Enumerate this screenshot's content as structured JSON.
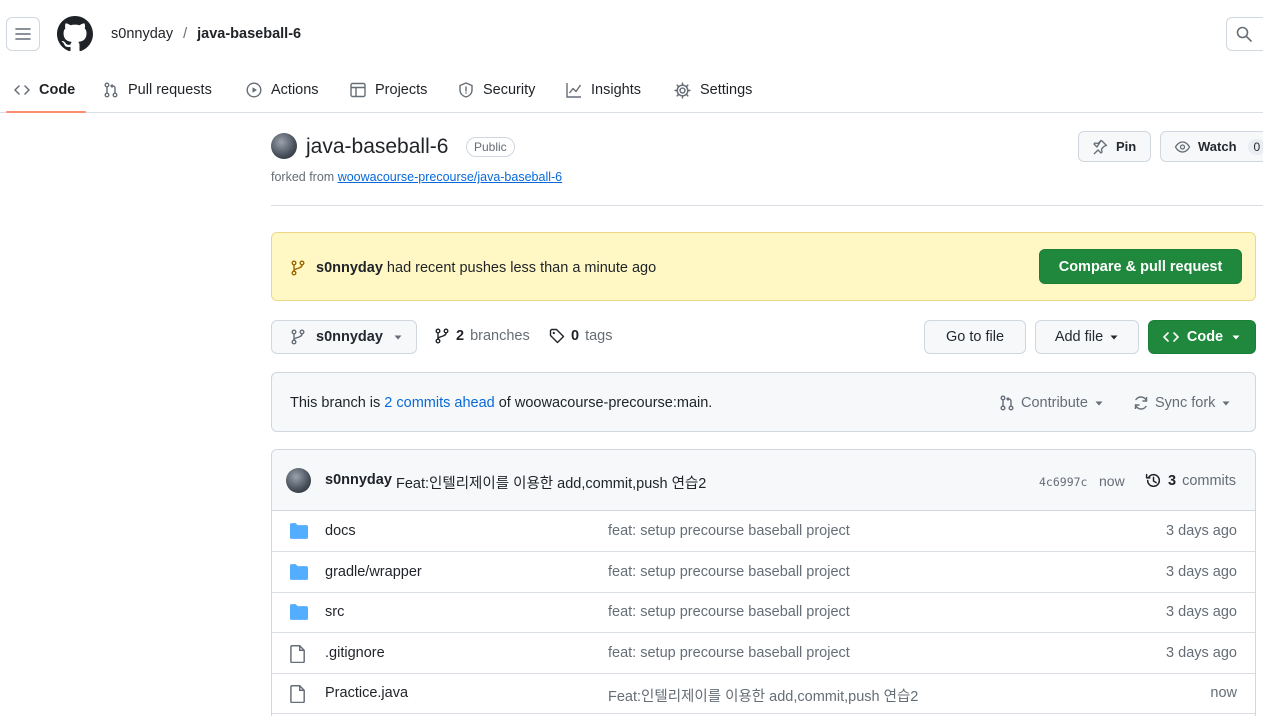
{
  "header": {
    "owner": "s0nnyday",
    "separator": "/",
    "repo": "java-baseball-6"
  },
  "tabs": [
    {
      "label": "Code",
      "icon": "code-icon",
      "selected": true
    },
    {
      "label": "Pull requests",
      "icon": "git-pull-request-icon"
    },
    {
      "label": "Actions",
      "icon": "play-icon"
    },
    {
      "label": "Projects",
      "icon": "table-icon"
    },
    {
      "label": "Security",
      "icon": "shield-icon"
    },
    {
      "label": "Insights",
      "icon": "graph-icon"
    },
    {
      "label": "Settings",
      "icon": "gear-icon"
    }
  ],
  "repo": {
    "title": "java-baseball-6",
    "visibility": "Public",
    "forked_prefix": "forked from ",
    "forked_source": "woowacourse-precourse/java-baseball-6",
    "pin_label": "Pin",
    "watch_label": "Watch",
    "watch_count": "0"
  },
  "banner": {
    "user": "s0nnyday",
    "message": " had recent pushes less than a minute ago",
    "button": "Compare & pull request"
  },
  "branchbar": {
    "branch": "s0nnyday",
    "branches_count": "2",
    "branches_label": "branches",
    "tags_count": "0",
    "tags_label": "tags",
    "go_to_file": "Go to file",
    "add_file": "Add file",
    "code": "Code"
  },
  "ahead": {
    "prefix": "This branch is ",
    "link": "2 commits ahead",
    "suffix": " of woowacourse-precourse:main.",
    "contribute": "Contribute",
    "sync": "Sync fork"
  },
  "latest_commit": {
    "author": "s0nnyday",
    "message": "Feat:인텔리제이를 이용한 add,commit,push 연습2",
    "sha": "4c6997c",
    "time": "now",
    "count": "3",
    "count_label": "commits"
  },
  "files": [
    {
      "name": "docs",
      "type": "folder",
      "message": "feat: setup precourse baseball project",
      "date": "3 days ago"
    },
    {
      "name": "gradle/wrapper",
      "type": "folder",
      "message": "feat: setup precourse baseball project",
      "date": "3 days ago"
    },
    {
      "name": "src",
      "type": "folder",
      "message": "feat: setup precourse baseball project",
      "date": "3 days ago"
    },
    {
      "name": ".gitignore",
      "type": "file",
      "message": "feat: setup precourse baseball project",
      "date": "3 days ago"
    },
    {
      "name": "Practice.java",
      "type": "file",
      "message": "Feat:인텔리제이를 이용한 add,commit,push 연습2",
      "date": "now"
    }
  ],
  "colors": {
    "accent_green": "#1f883d",
    "link_blue": "#0969da",
    "banner_yellow": "#fff8c5",
    "tab_underline": "#fd8c73",
    "folder_blue": "#54aeff"
  }
}
